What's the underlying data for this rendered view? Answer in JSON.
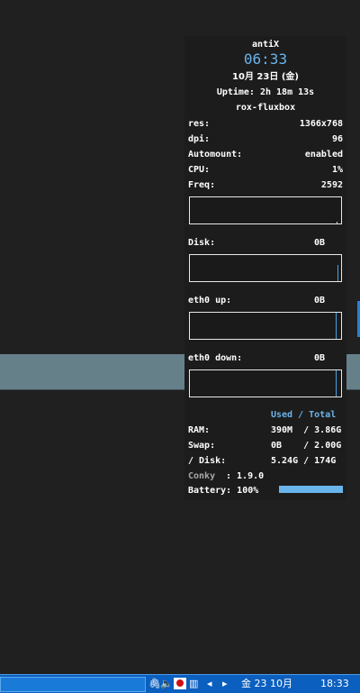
{
  "conky": {
    "distro": "antiX",
    "time": "06:33",
    "date": "10月 23日 (金)",
    "uptime": "Uptime: 2h 18m 13s",
    "desktop": "rox-fluxbox",
    "stats": [
      {
        "label": "res:",
        "value": "1366x768"
      },
      {
        "label": "dpi:",
        "value": "96"
      },
      {
        "label": "Automount:",
        "value": "enabled"
      },
      {
        "label": "CPU:",
        "value": "1%"
      },
      {
        "label": "Freq:",
        "value": "2592"
      }
    ],
    "disk": {
      "label": "Disk:",
      "value": "0B"
    },
    "eth0_up": {
      "label": "eth0 up:",
      "value": "0B"
    },
    "eth0_down": {
      "label": "eth0 down:",
      "value": "0B"
    },
    "table_header": "Used / Total",
    "mem_rows": [
      {
        "label": "RAM:",
        "value": "390M  / 3.86G"
      },
      {
        "label": "Swap:",
        "value": "0B    / 2.00G"
      },
      {
        "label": "/ Disk:",
        "value": "5.24G / 174G"
      }
    ],
    "conky_label": "Conky",
    "conky_version": ": 1.9.0",
    "battery": "Battery: 100%",
    "battery_level": 1.0
  },
  "taskbar": {
    "nav_left": "◂",
    "nav_right": "▸",
    "date": "金 23 10月",
    "time": "18:33"
  }
}
